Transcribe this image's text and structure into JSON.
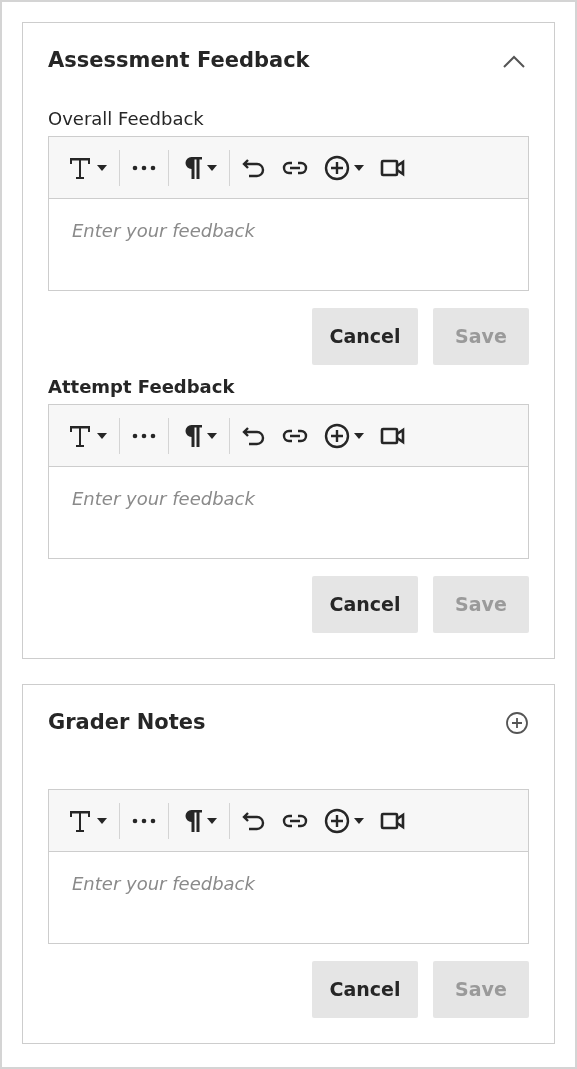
{
  "sections": [
    {
      "title": "Assessment Feedback",
      "kind": "collapsible",
      "expanded": true,
      "editors": [
        {
          "label": "Overall Feedback",
          "bold": false,
          "placeholder": "Enter your feedback",
          "buttons": [
            {
              "label": "Cancel",
              "disabled": false
            },
            {
              "label": "Save",
              "disabled": true
            }
          ]
        },
        {
          "label": "Attempt Feedback",
          "bold": true,
          "placeholder": "Enter your feedback",
          "buttons": [
            {
              "label": "Cancel",
              "disabled": false
            },
            {
              "label": "Save",
              "disabled": true
            }
          ]
        }
      ]
    },
    {
      "title": "Grader Notes",
      "kind": "addable",
      "editors": [
        {
          "placeholder": "Enter your feedback",
          "buttons": [
            {
              "label": "Cancel",
              "disabled": false
            },
            {
              "label": "Save",
              "disabled": true
            }
          ]
        }
      ]
    }
  ]
}
